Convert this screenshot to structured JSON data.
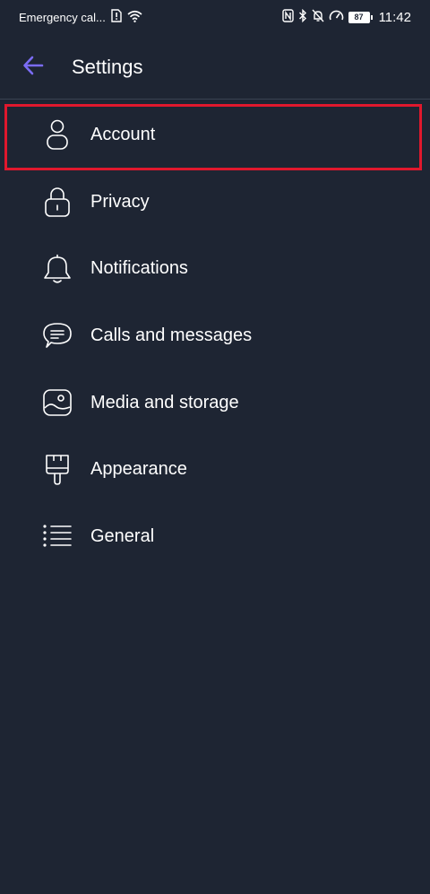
{
  "status_bar": {
    "carrier_text": "Emergency cal...",
    "battery_level": "87",
    "time": "11:42"
  },
  "app_bar": {
    "title": "Settings"
  },
  "settings": {
    "items": [
      {
        "label": "Account",
        "icon": "person-icon"
      },
      {
        "label": "Privacy",
        "icon": "lock-icon"
      },
      {
        "label": "Notifications",
        "icon": "bell-icon"
      },
      {
        "label": "Calls and messages",
        "icon": "chat-bubble-icon"
      },
      {
        "label": "Media and storage",
        "icon": "image-icon"
      },
      {
        "label": "Appearance",
        "icon": "paint-brush-icon"
      },
      {
        "label": "General",
        "icon": "list-icon"
      }
    ],
    "highlighted_item": "Account"
  },
  "colors": {
    "background": "#1e2533",
    "accent": "#7b6cf6",
    "highlight_border": "#e0182d",
    "text": "#ffffff"
  }
}
